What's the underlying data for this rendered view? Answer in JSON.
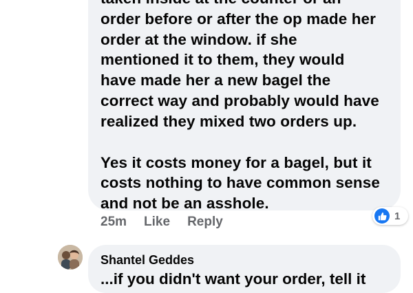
{
  "comment": {
    "paragraph1": [
      "taken inside at the counter or an",
      "order before or after the op made her",
      "order at the window. if she",
      "mentioned it to them, they would",
      "have made her a new bagel the",
      "correct way and probably would have",
      "realized they mixed two orders up."
    ],
    "paragraph2": [
      "Yes it costs money for a bagel, but it",
      "costs nothing to have common sense",
      "and not be an asshole."
    ],
    "time": "25m",
    "like_label": "Like",
    "reply_label": "Reply",
    "reaction_count": "1"
  },
  "next_comment": {
    "author": "Shantel Geddes",
    "partial_text": "...if you didn't want your order, tell it"
  },
  "colors": {
    "bubble": "#f0f2f5",
    "like_blue": "#1877f2",
    "meta_gray": "#65676b"
  },
  "icons": {
    "reaction": "like-reaction-icon",
    "avatar": "profile-avatar"
  }
}
